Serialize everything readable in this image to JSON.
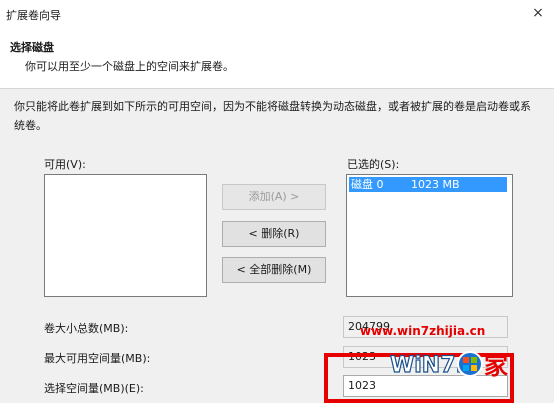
{
  "window": {
    "title": "扩展卷向导",
    "close_glyph": "×"
  },
  "header": {
    "title": "选择磁盘",
    "subtitle": "你可以用至少一个磁盘上的空间来扩展卷。"
  },
  "description": "你只能将此卷扩展到如下所示的可用空间，因为不能将磁盘转换为动态磁盘，或者被扩展的卷是启动卷或系统卷。",
  "available": {
    "label": "可用(V):",
    "items": []
  },
  "selected": {
    "label": "已选的(S):",
    "items": [
      {
        "disk": "磁盘 0",
        "size": "1023 MB"
      }
    ]
  },
  "buttons": {
    "add": "添加(A) >",
    "remove": "< 删除(R)",
    "remove_all": "< 全部删除(M)"
  },
  "fields": {
    "total_size_label": "卷大小总数(MB):",
    "total_size_value": "204799",
    "max_space_label": "最大可用空间量(MB):",
    "max_space_value": "1023",
    "select_space_label": "选择空间量(MB)(E):",
    "select_space_value": "1023"
  },
  "watermark": {
    "url": "www.win7zhijia.cn",
    "logo_text": "WiN7.",
    "logo_char": "家"
  },
  "colors": {
    "selection": "#3399ff",
    "highlight_box": "#e60000"
  }
}
